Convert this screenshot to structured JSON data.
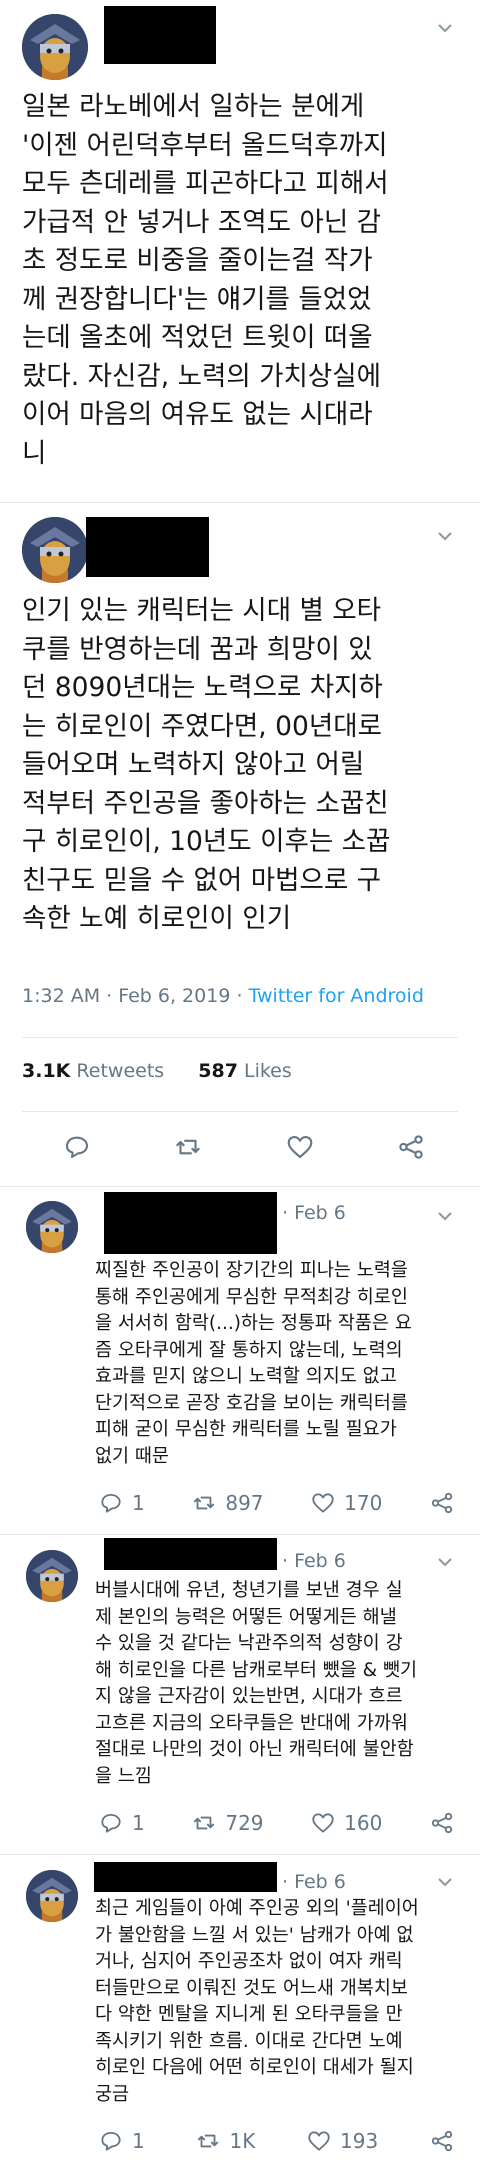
{
  "tweet1": {
    "text": "일본 라노베에서 일하는 분에게\n'이젠 어린덕후부터 올드덕후까지\n모두 츤데레를 피곤하다고 피해서\n가급적 안 넣거나 조역도 아닌 감\n초 정도로 비중을 줄이는걸 작가\n께 권장합니다'는 얘기를 들었었\n는데 올초에 적었던 트윗이 떠올\n랐다. 자신감, 노력의 가치상실에\n이어 마음의 여유도 없는 시대라\n니"
  },
  "tweet2": {
    "text": "인기 있는 캐릭터는 시대 별 오타\n쿠를 반영하는데 꿈과 희망이 있\n던 8090년대는 노력으로 차지하\n는 히로인이 주였다면, 00년대로\n들어오며 노력하지 않아고 어릴\n적부터 주인공을 좋아하는 소꿉친\n구 히로인이, 10년도 이후는 소꿉\n친구도 믿을 수 없어 마법으로 구\n속한 노예 히로인이 인기",
    "time": "1:32 AM · Feb 6, 2019 · ",
    "source": "Twitter for Android",
    "retweets": "3.1K",
    "retweets_label": " Retweets",
    "likes": "587",
    "likes_label": " Likes"
  },
  "replies": [
    {
      "date": "· Feb 6",
      "text": "찌질한 주인공이 장기간의 피나는 노력을\n통해 주인공에게 무심한 무적최강 히로인\n을 서서히 함락(...)하는 정통파 작품은 요\n즘 오타쿠에게 잘 통하지 않는데, 노력의\n효과를 믿지 않으니 노력할 의지도 없고\n단기적으로 곧장 호감을 보이는 캐릭터를\n피해 굳이 무심한 캐릭터를 노릴 필요가\n없기 때문",
      "reply_count": "1",
      "retweet_count": "897",
      "like_count": "170"
    },
    {
      "date": "· Feb 6",
      "text": "버블시대에 유년, 청년기를 보낸 경우 실\n제 본인의 능력은 어떻든 어떻게든 해낼\n수 있을 것 같다는 낙관주의적 성향이 강\n해 히로인을 다른 남캐로부터 뺐을 & 뺏기\n지 않을 근자감이 있는반면, 시대가 흐르\n고흐른 지금의 오타쿠들은 반대에 가까워\n절대로 나만의 것이 아닌 캐릭터에 불안함\n을 느낌",
      "reply_count": "1",
      "retweet_count": "729",
      "like_count": "160"
    },
    {
      "date": "· Feb 6",
      "text": "최근 게임들이 아예 주인공 외의 '플레이어\n가 불안함을 느낄 서 있는' 남캐가 아예 없\n거나, 심지어 주인공조차 없이 여자 캐릭\n터들만으로 이뤄진 것도 어느새 개복치보\n다 약한 멘탈을 지니게 된 오타쿠들을 만\n족시키기 위한 흐름. 이대로 간다면 노예\n히로인 다음에 어떤 히로인이 대세가 될지\n궁금",
      "reply_count": "1",
      "retweet_count": "1K",
      "like_count": "193"
    }
  ]
}
